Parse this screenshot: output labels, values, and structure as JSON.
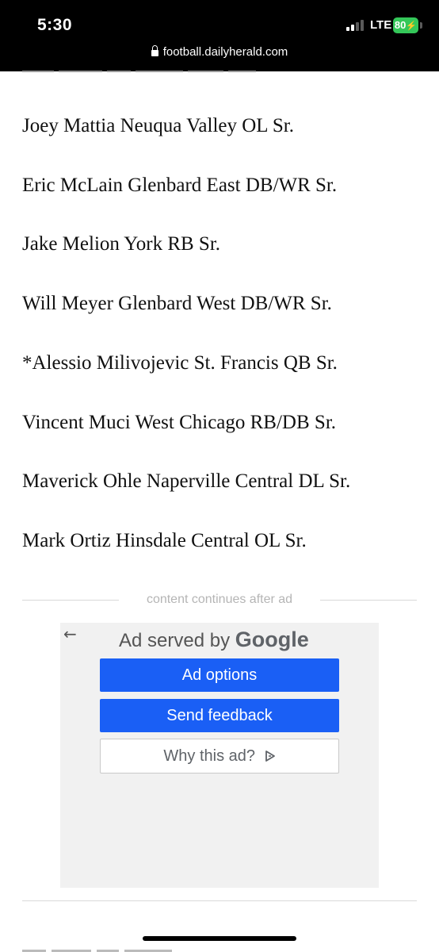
{
  "status_bar": {
    "time": "5:30",
    "network": "LTE",
    "battery": "80"
  },
  "url_bar": {
    "domain": "football.dailyherald.com"
  },
  "roster": [
    "Joey Mattia Neuqua Valley OL Sr.",
    "Eric McLain Glenbard East DB/WR Sr.",
    "Jake Melion York RB Sr.",
    "Will Meyer Glenbard West DB/WR Sr.",
    "*Alessio Milivojevic St. Francis QB Sr.",
    "Vincent Muci West Chicago RB/DB Sr.",
    "Maverick Ohle Naperville Central DL Sr.",
    "Mark Ortiz Hinsdale Central OL Sr."
  ],
  "ad": {
    "separator_label": "content continues after ad",
    "served_by": "Ad served by",
    "brand": "Google",
    "buttons": {
      "ad_options": "Ad options",
      "send_feedback": "Send feedback",
      "why_this_ad": "Why this ad?"
    }
  },
  "colors": {
    "button_blue": "#1a5ff5",
    "battery_green": "#34c759",
    "text": "#111111"
  }
}
